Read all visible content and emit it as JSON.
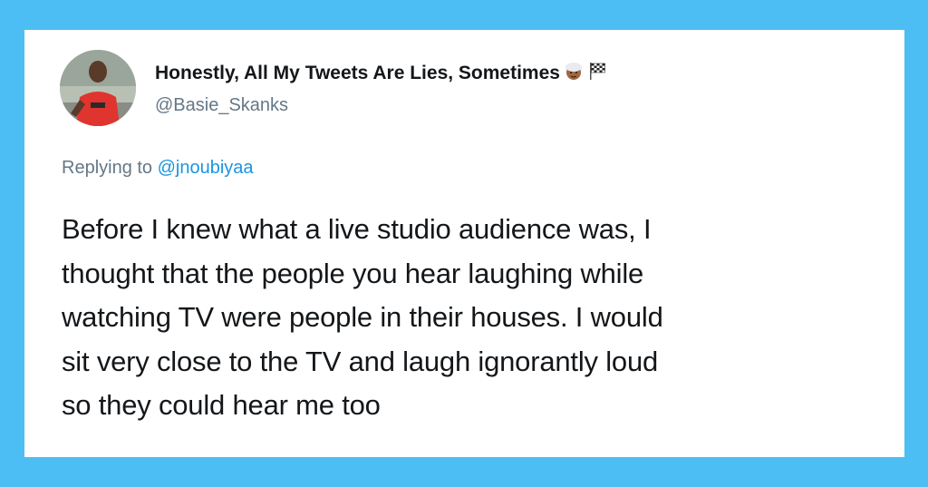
{
  "tweet": {
    "display_name": "Honestly, All My Tweets Are Lies, Sometimes",
    "name_emojis": [
      "man-with-turban-emoji",
      "chequered-flag-emoji"
    ],
    "handle": "@Basie_Skanks",
    "replying_prefix": "Replying to",
    "replying_to": "@jnoubiyaa",
    "text_lines": [
      "Before I knew what a live studio audience was, I",
      "thought that the people you hear laughing while",
      "watching TV were people in their houses. I would",
      "sit very close to the TV and laugh ignorantly loud",
      "so they could hear me too"
    ]
  },
  "colors": {
    "background": "#4dbef4",
    "card": "#ffffff",
    "text": "#14171a",
    "secondary_text": "#657786",
    "link": "#1b95e0"
  }
}
